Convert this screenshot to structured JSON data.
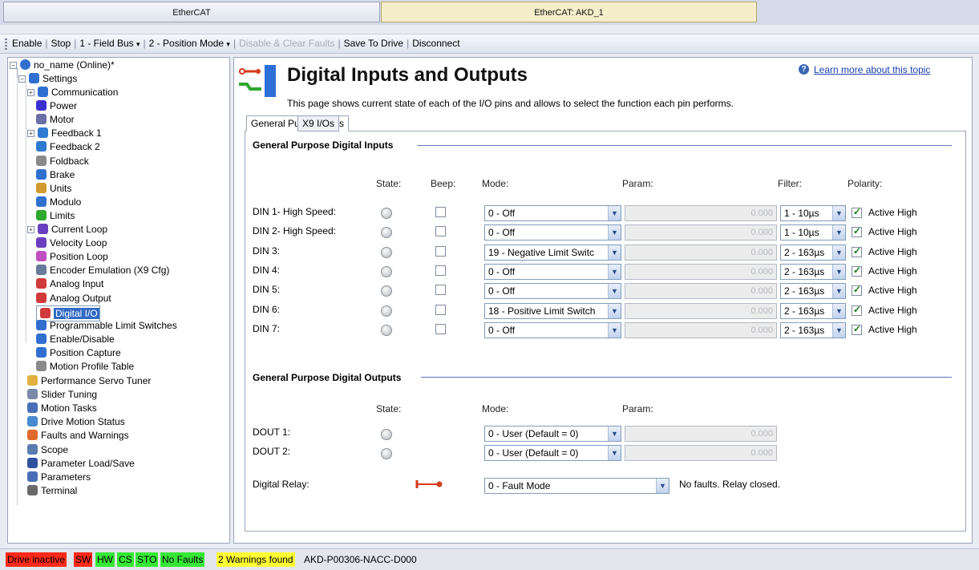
{
  "window_tabs": [
    "EtherCAT",
    "EtherCAT: AKD_1"
  ],
  "toolbar": {
    "enable": "Enable",
    "stop": "Stop",
    "field_bus": "1 - Field Bus",
    "position_mode": "2 - Position Mode",
    "disable_clear": "Disable & Clear Faults",
    "save": "Save To Drive",
    "disconnect": "Disconnect"
  },
  "tree": {
    "root": "no_name (Online)*",
    "settings": "Settings",
    "items": [
      "Communication",
      "Power",
      "Motor",
      "Feedback 1",
      "Feedback 2",
      "Foldback",
      "Brake",
      "Units",
      "Modulo",
      "Limits",
      "Current Loop",
      "Velocity Loop",
      "Position Loop",
      "Encoder Emulation (X9 Cfg)",
      "Analog Input",
      "Analog Output",
      "Digital I/O",
      "Programmable Limit Switches",
      "Enable/Disable",
      "Position Capture",
      "Motion Profile Table"
    ],
    "top": [
      "Performance Servo Tuner",
      "Slider Tuning",
      "Motion Tasks",
      "Drive Motion Status",
      "Faults and Warnings",
      "Scope",
      "Parameter Load/Save",
      "Parameters",
      "Terminal"
    ]
  },
  "page": {
    "title": "Digital Inputs and Outputs",
    "learn_more": "Learn more about this topic",
    "help_glyph": "?",
    "description": "This page shows current state of each of the I/O pins and allows to select the function each pin performs.",
    "tabs": [
      "General Purpose I/Os",
      "X9 I/Os"
    ]
  },
  "inputs": {
    "section": "General Purpose Digital Inputs",
    "headers": {
      "state": "State:",
      "beep": "Beep:",
      "mode": "Mode:",
      "param": "Param:",
      "filter": "Filter:",
      "polarity": "Polarity:"
    },
    "rows": [
      {
        "label": "DIN 1- High Speed:",
        "mode": "0 - Off",
        "param": "0.000",
        "filter": "1 - 10µs",
        "polarity": "Active High"
      },
      {
        "label": "DIN 2- High Speed:",
        "mode": "0 - Off",
        "param": "0.000",
        "filter": "1 - 10µs",
        "polarity": "Active High"
      },
      {
        "label": "DIN 3:",
        "mode": "19 - Negative Limit Switc",
        "param": "0.000",
        "filter": "2 - 163µs",
        "polarity": "Active High"
      },
      {
        "label": "DIN 4:",
        "mode": "0 - Off",
        "param": "0.000",
        "filter": "2 - 163µs",
        "polarity": "Active High"
      },
      {
        "label": "DIN 5:",
        "mode": "0 - Off",
        "param": "0.000",
        "filter": "2 - 163µs",
        "polarity": "Active High"
      },
      {
        "label": "DIN 6:",
        "mode": "18 - Positive Limit Switch",
        "param": "0.000",
        "filter": "2 - 163µs",
        "polarity": "Active High"
      },
      {
        "label": "DIN 7:",
        "mode": "0 - Off",
        "param": "0.000",
        "filter": "2 - 163µs",
        "polarity": "Active High"
      }
    ]
  },
  "outputs": {
    "section": "General Purpose Digital Outputs",
    "headers": {
      "state": "State:",
      "mode": "Mode:",
      "param": "Param:"
    },
    "rows": [
      {
        "label": "DOUT 1:",
        "mode": "0 - User (Default = 0)",
        "param": "0.000"
      },
      {
        "label": "DOUT 2:",
        "mode": "0 - User (Default = 0)",
        "param": "0.000"
      }
    ],
    "relay": {
      "label": "Digital Relay:",
      "mode": "0 - Fault Mode",
      "status": "No faults. Relay closed."
    }
  },
  "status_bar": {
    "drive": "Drive inactive",
    "sw": "SW",
    "hw": "HW",
    "cs": "CS",
    "sto": "STO",
    "faults": "No Faults",
    "warnings": "2  Warnings found",
    "model": "AKD-P00306-NACC-D000"
  },
  "colors": {
    "red": "#ff2a1a",
    "green": "#36e836",
    "yellow": "#ffff33",
    "selection": "#316ac5"
  }
}
